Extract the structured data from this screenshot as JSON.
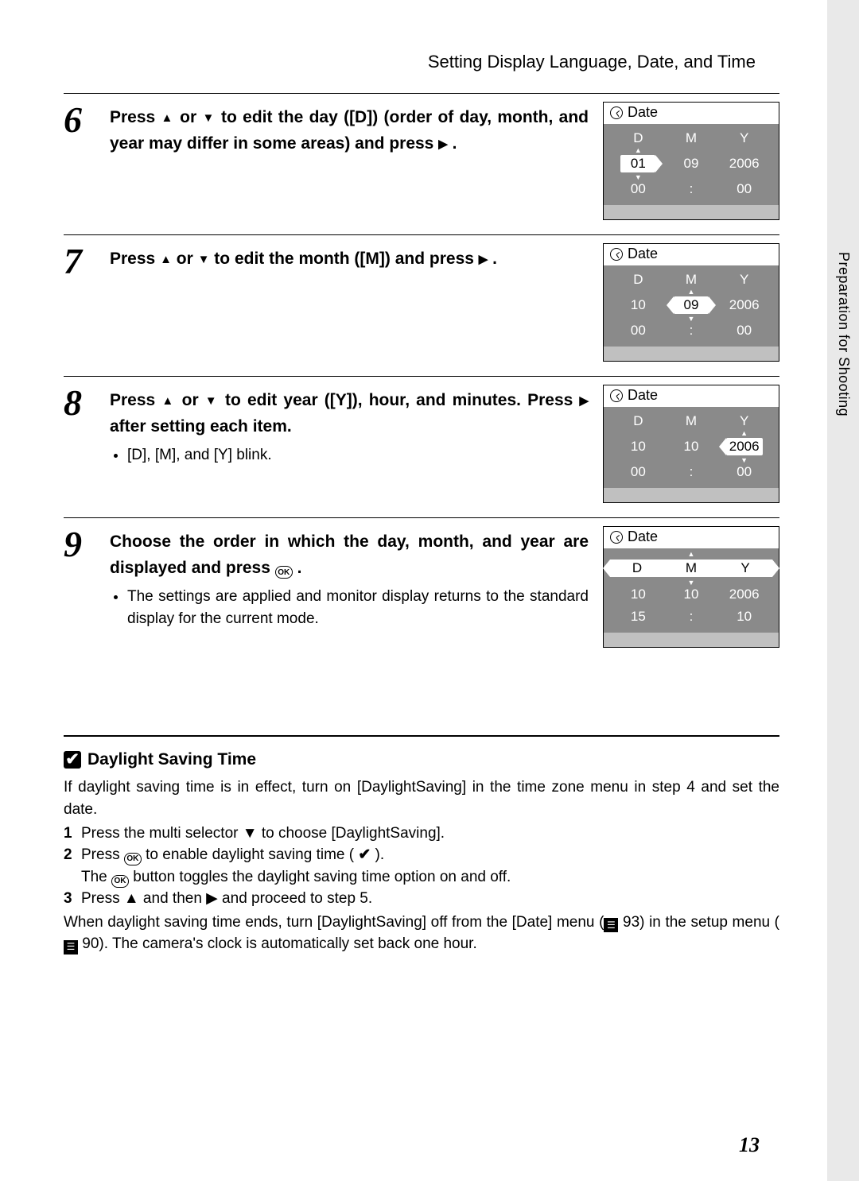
{
  "header": "Setting Display Language, Date, and Time",
  "sideTab": "Preparation for Shooting",
  "pageNumber": "13",
  "lcdTitle": "Date",
  "steps": {
    "s6": {
      "num": "6",
      "text_a": "Press ",
      "text_b": " or ",
      "text_c": " to edit the day ([D]) (order of day, month, and year may differ in some areas) and press ",
      "text_d": " .",
      "lcd": {
        "h": [
          "D",
          "M",
          "Y"
        ],
        "v": [
          "01",
          "09",
          "2006"
        ],
        "t": [
          "00",
          ":",
          "00"
        ],
        "sel": 0
      }
    },
    "s7": {
      "num": "7",
      "text_a": "Press ",
      "text_b": " or ",
      "text_c": " to edit the month ([M]) and press ",
      "text_d": " .",
      "lcd": {
        "h": [
          "D",
          "M",
          "Y"
        ],
        "v": [
          "10",
          "09",
          "2006"
        ],
        "t": [
          "00",
          ":",
          "00"
        ],
        "sel": 1
      }
    },
    "s8": {
      "num": "8",
      "text_a": "Press ",
      "text_b": " or ",
      "text_c": " to edit year ([Y]), hour, and minutes. Press ",
      "text_d": " after setting each item.",
      "bullets": [
        "[D], [M], and [Y] blink."
      ],
      "lcd": {
        "h": [
          "D",
          "M",
          "Y"
        ],
        "v": [
          "10",
          "10",
          "2006"
        ],
        "t": [
          "00",
          ":",
          "00"
        ],
        "sel": 2
      }
    },
    "s9": {
      "num": "9",
      "text_a": "Choose the order in which the day, month, and year are displayed and press ",
      "text_b": " .",
      "bullets": [
        "The settings are applied and monitor display returns to the standard display for the current mode."
      ],
      "lcd": {
        "bar": [
          "D",
          "M",
          "Y"
        ],
        "v": [
          "10",
          "10",
          "2006"
        ],
        "t": [
          "15",
          ":",
          "10"
        ]
      }
    }
  },
  "note": {
    "title": "Daylight Saving Time",
    "intro": "If daylight saving time is in effect, turn on [DaylightSaving] in the time zone menu in step 4 and set the date.",
    "li1": "Press the multi selector ▼ to choose [DaylightSaving].",
    "li2a": "Press ",
    "li2b": " to enable daylight saving time ( ",
    "li2c": " ).",
    "li2sub_a": "The ",
    "li2sub_b": " button toggles the daylight saving time option on and off.",
    "li3": "Press ▲ and then ▶ and proceed to step 5.",
    "out_a": "When daylight saving time ends, turn [DaylightSaving] off from the [Date] menu (",
    "out_b": " 93) in the setup menu (",
    "out_c": " 90). The camera's clock is automatically set back one hour."
  }
}
